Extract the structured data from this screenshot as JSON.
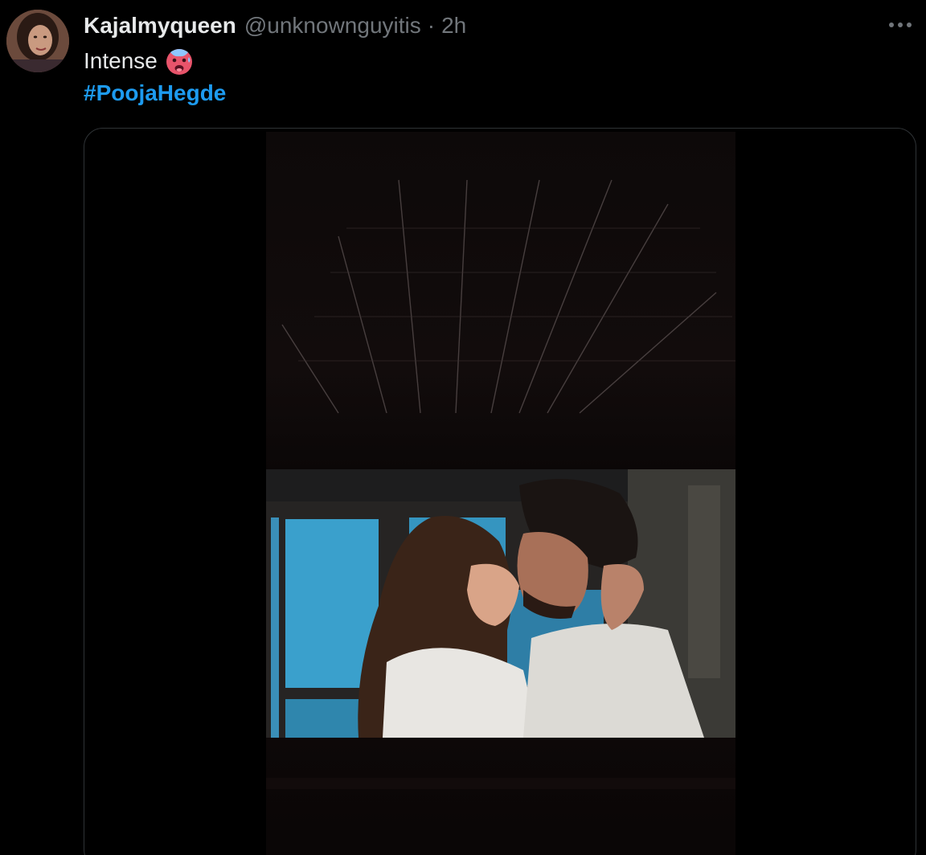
{
  "tweet": {
    "display_name": "Kajalmyqueen",
    "handle": "@unknownguyitis",
    "separator": "·",
    "time": "2h",
    "text": "Intense",
    "emoji": "hot-face-emoji",
    "hashtag": "#PoojaHegde"
  },
  "icons": {
    "more": "more-horizontal-icon"
  },
  "colors": {
    "background": "#000000",
    "text_primary": "#e7e9ea",
    "text_secondary": "#71767b",
    "link": "#1d9bf0",
    "border": "#2f3336"
  }
}
